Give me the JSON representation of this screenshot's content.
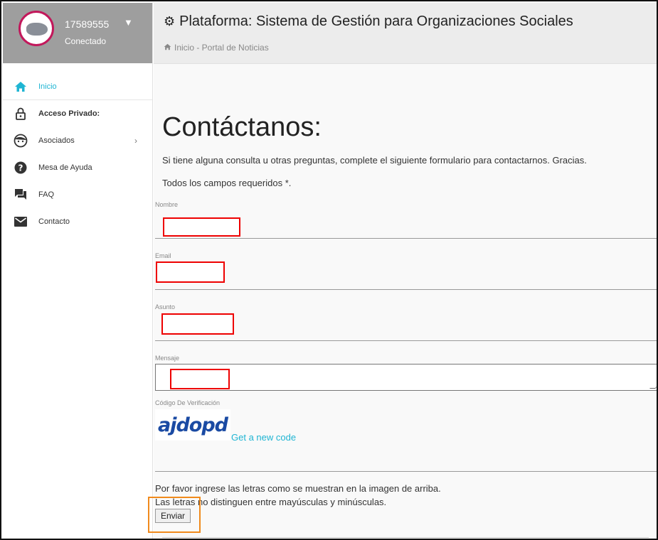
{
  "user": {
    "name": "17589555",
    "status": "Conectado"
  },
  "sidebar": {
    "items": [
      {
        "label": "Inicio",
        "icon": "home-icon"
      },
      {
        "label": "Acceso Privado:",
        "icon": "lock-icon"
      },
      {
        "label": "Asociados",
        "icon": "face-icon"
      },
      {
        "label": "Mesa de Ayuda",
        "icon": "help-icon"
      },
      {
        "label": "FAQ",
        "icon": "forum-icon"
      },
      {
        "label": "Contacto",
        "icon": "mail-icon"
      }
    ]
  },
  "header": {
    "title": "Plataforma: Sistema de Gestión para Organizaciones Sociales",
    "breadcrumb": "Inicio - Portal de Noticias"
  },
  "content": {
    "heading": "Contáctanos:",
    "intro": "Si tiene alguna consulta u otras preguntas, complete el siguiente formulario para contactarnos. Gracias.",
    "required": "Todos los campos requeridos *."
  },
  "form": {
    "nombre_label": "Nombre",
    "email_label": "Email",
    "asunto_label": "Asunto",
    "mensaje_label": "Mensaje",
    "captcha_label": "Código De Verificación",
    "captcha_text": "ajdopd",
    "new_code": "Get a new code",
    "help_line1": "Por favor ingrese las letras como se muestran en la imagen de arriba.",
    "help_line2": "Las letras no distinguen entre mayúsculas y minúsculas.",
    "submit_label": "Enviar"
  },
  "colors": {
    "accent": "#1fb5d3",
    "highlight_red": "#e00000",
    "highlight_orange": "#f08a1c",
    "user_header_bg": "#9e9e9e"
  }
}
